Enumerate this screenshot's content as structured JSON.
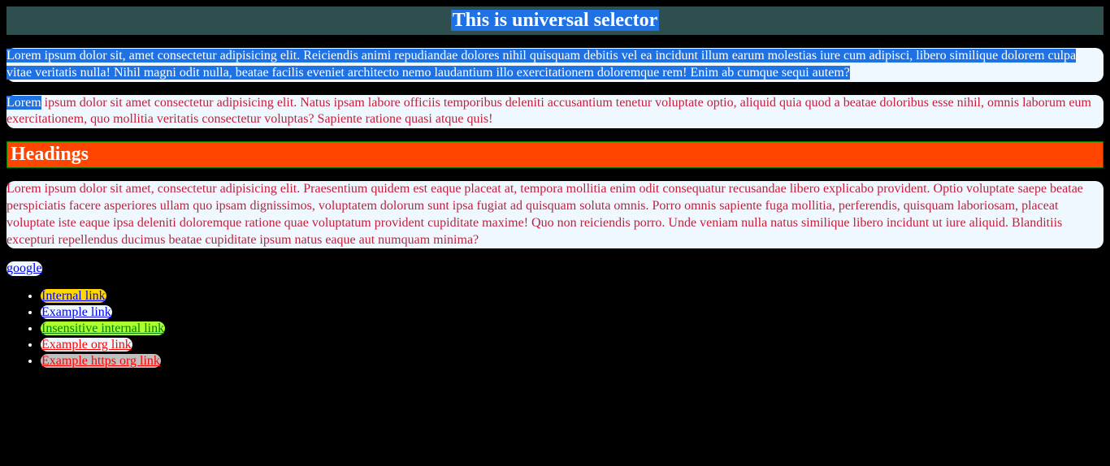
{
  "header": {
    "title": "This is universal selector"
  },
  "paragraph1": {
    "text_hl": "Lorem ipsum dolor sit, amet consectetur adipisicing elit. Reiciendis animi repudiandae dolores nihil quisquam debitis vel ea incidunt illum earum molestias iure cum adipisci, libero similique dolorem culpa vitae veritatis nulla! Nihil magni odit nulla, beatae facilis eveniet architecto nemo laudantium illo exercitationem doloremque rem! Enim ab cumque sequi autem?"
  },
  "paragraph2": {
    "prefix_hl": "Lorem",
    "rest": " ipsum dolor sit amet consectetur adipisicing elit. Natus ipsam labore officiis temporibus deleniti accusantium tenetur voluptate optio, aliquid quia quod a beatae doloribus esse nihil, omnis laborum eum exercitationem, quo mollitia veritatis consectetur voluptas? Sapiente ratione quasi atque quis!"
  },
  "headings_section": {
    "title": "Headings"
  },
  "paragraph3": {
    "text": "Lorem ipsum dolor sit amet, consectetur adipisicing elit. Praesentium quidem est eaque placeat at, tempora mollitia enim odit consequatur recusandae libero explicabo provident. Optio voluptate saepe beatae perspiciatis facere asperiores ullam quo ipsam dignissimos, voluptatem dolorum sunt ipsa fugiat ad quisquam soluta omnis. Porro omnis sapiente fuga mollitia, perferendis, quisquam laboriosam, placeat voluptate iste eaque ipsa deleniti doloremque ratione quae voluptatum provident cupiditate maxime! Quo non reiciendis porro. Unde veniam nulla natus similique libero incidunt ut iure aliquid. Blanditiis excepturi repellendus ducimus beatae cupiditate ipsum natus eaque aut numquam minima?"
  },
  "google_link": {
    "label": "google"
  },
  "links": {
    "item0": "Internal link",
    "item1": "Example link",
    "item2": "Insensitive internal link",
    "item3": "Example org link",
    "item4": "Example https org link"
  }
}
